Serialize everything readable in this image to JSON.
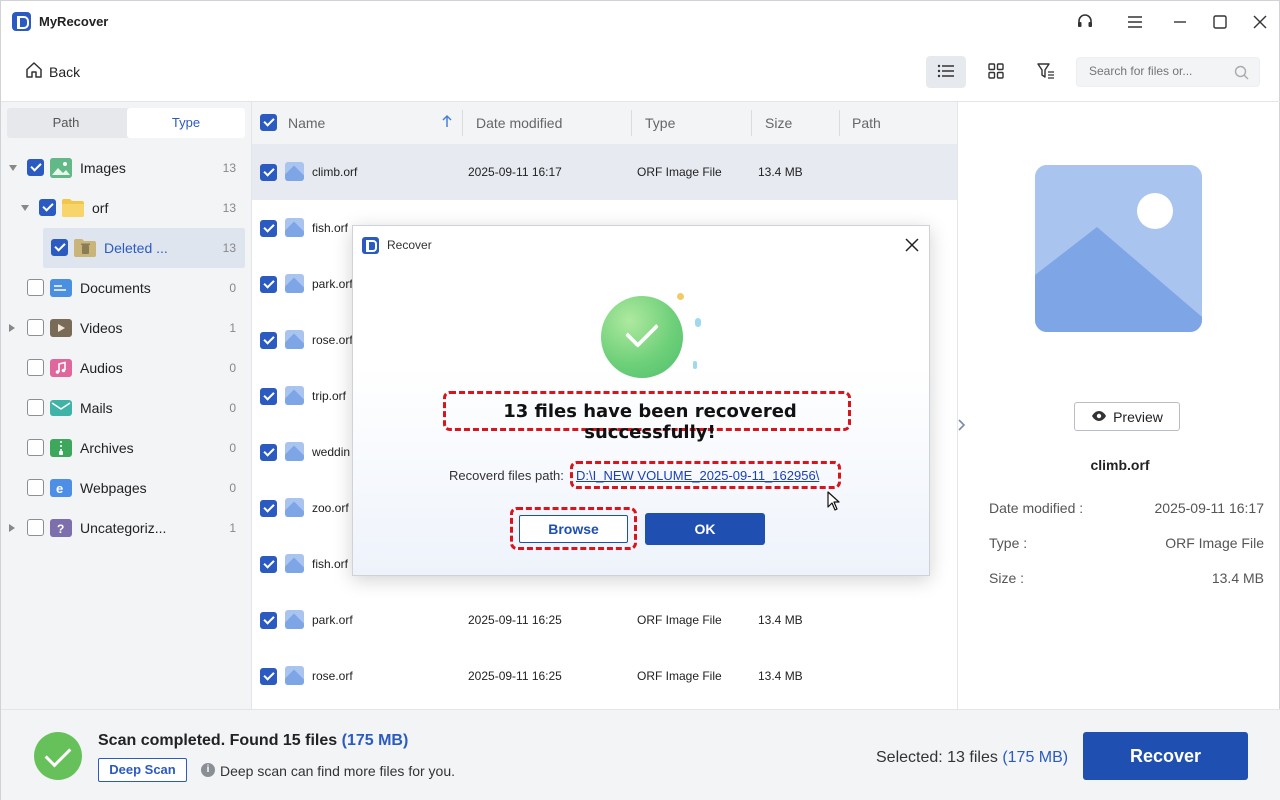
{
  "app": {
    "title": "MyRecover"
  },
  "toolbar": {
    "back_label": "Back",
    "search_placeholder": "Search for files or..."
  },
  "sidebar": {
    "tabs": [
      "Path",
      "Type"
    ],
    "active_tab": "Type",
    "items": [
      {
        "label": "Images",
        "count": "13",
        "checked": true,
        "icon": "images-icon"
      },
      {
        "label": "orf",
        "count": "13",
        "checked": true,
        "icon": "folder-icon"
      },
      {
        "label": "Deleted ...",
        "count": "13",
        "checked": true,
        "icon": "recycle-bin-icon"
      },
      {
        "label": "Documents",
        "count": "0",
        "checked": false,
        "icon": "documents-icon"
      },
      {
        "label": "Videos",
        "count": "1",
        "checked": false,
        "icon": "videos-icon"
      },
      {
        "label": "Audios",
        "count": "0",
        "checked": false,
        "icon": "audios-icon"
      },
      {
        "label": "Mails",
        "count": "0",
        "checked": false,
        "icon": "mails-icon"
      },
      {
        "label": "Archives",
        "count": "0",
        "checked": false,
        "icon": "archives-icon"
      },
      {
        "label": "Webpages",
        "count": "0",
        "checked": false,
        "icon": "webpages-icon"
      },
      {
        "label": "Uncategoriz...",
        "count": "1",
        "checked": false,
        "icon": "uncategorized-icon"
      }
    ]
  },
  "list": {
    "columns": [
      "Name",
      "Date modified",
      "Type",
      "Size",
      "Path"
    ],
    "rows": [
      {
        "name": "climb.orf",
        "date": "2025-09-11 16:17",
        "type": "ORF Image File",
        "size": "13.4 MB"
      },
      {
        "name": "fish.orf",
        "date": "",
        "type": "",
        "size": ""
      },
      {
        "name": "park.orf",
        "date": "",
        "type": "",
        "size": ""
      },
      {
        "name": "rose.orf",
        "date": "",
        "type": "",
        "size": ""
      },
      {
        "name": "trip.orf",
        "date": "",
        "type": "",
        "size": ""
      },
      {
        "name": "weddin",
        "date": "",
        "type": "",
        "size": ""
      },
      {
        "name": "zoo.orf",
        "date": "",
        "type": "",
        "size": ""
      },
      {
        "name": "fish.orf",
        "date": "",
        "type": "",
        "size": ""
      },
      {
        "name": "park.orf",
        "date": "2025-09-11 16:25",
        "type": "ORF Image File",
        "size": "13.4 MB"
      },
      {
        "name": "rose.orf",
        "date": "2025-09-11 16:25",
        "type": "ORF Image File",
        "size": "13.4 MB"
      }
    ]
  },
  "details": {
    "preview_label": "Preview",
    "file_name": "climb.orf",
    "date_label": "Date modified :",
    "date_value": "2025-09-11 16:17",
    "type_label": "Type :",
    "type_value": "ORF Image File",
    "size_label": "Size :",
    "size_value": "13.4 MB"
  },
  "status": {
    "scan_text": "Scan completed. Found 15 files",
    "scan_size": "(175 MB)",
    "deep_scan_label": "Deep Scan",
    "deep_tip": "Deep scan can find more files for you.",
    "selected_text": "Selected: 13 files",
    "selected_size": "(175 MB)",
    "recover_label": "Recover"
  },
  "dialog": {
    "title": "Recover",
    "message": "13 files have been recovered successfully!",
    "path_label": "Recoverd files path:",
    "path_value": "D:\\I_NEW VOLUME_2025-09-11_162956\\",
    "browse_label": "Browse",
    "ok_label": "OK"
  },
  "colors": {
    "accent": "#1f4fb0",
    "highlight": "#d9141c",
    "success": "#67c15a"
  }
}
